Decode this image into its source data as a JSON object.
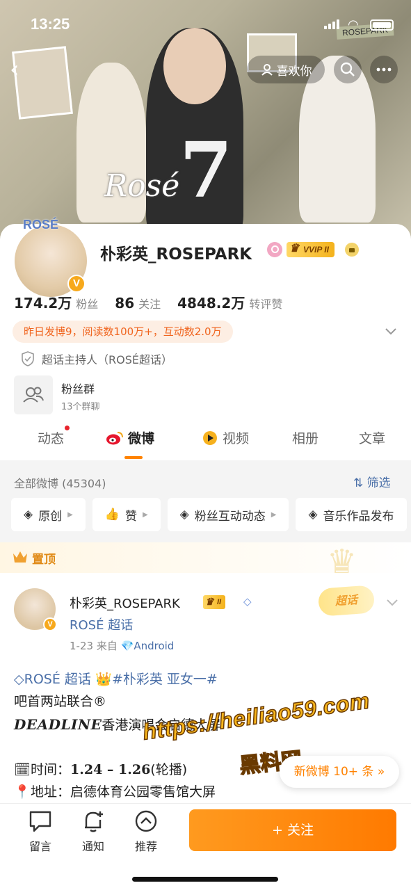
{
  "status_bar": {
    "time": "13:25"
  },
  "banner": {
    "like_label": "喜欢你",
    "stamp_tag": "ROSEPARK",
    "script_text": "Rosé"
  },
  "profile": {
    "name": "朴彩英_ROSEPARK",
    "vip_badge": "VVIP II",
    "verified_mark": "V",
    "avatar_caption": "ROSÉ",
    "stats": [
      {
        "num": "174.2万",
        "label": "粉丝"
      },
      {
        "num": "86",
        "label": "关注"
      },
      {
        "num": "4848.2万",
        "label": "转评赞"
      }
    ],
    "activity": "昨日发博9，阅读数100万+，互动数2.0万",
    "host": "超话主持人（ROSÉ超话）",
    "fan_group": {
      "title": "粉丝群",
      "subtitle": "13个群聊"
    }
  },
  "tabs": [
    {
      "label": "动态"
    },
    {
      "label": "微博"
    },
    {
      "label": "视频"
    },
    {
      "label": "相册"
    },
    {
      "label": "文章"
    }
  ],
  "filter": {
    "all_label": "全部微博 (45304)",
    "filter_label": "筛选",
    "chips": [
      "原创",
      "赞",
      "粉丝互动动态",
      "音乐作品发布"
    ]
  },
  "pinned": {
    "label": "置顶"
  },
  "post": {
    "author": "朴彩英_ROSEPARK",
    "badge": "II",
    "topic": "ROSÉ 超话",
    "date": "1-23",
    "from": "来自",
    "source": "Android",
    "super_topic_tag": "超话",
    "line1_topic": "ROSÉ 超话",
    "line1_hashtag": "#朴彩英 亚女一#",
    "line2": "吧首两站联合®",
    "line3_bold": "DEADLINE",
    "line3_rest": "香港演唱会启德大屏",
    "line4_label": "时间：",
    "line4_value": "1.24 – 1.26",
    "line4_note": "(轮播)",
    "line5_label": "地址：",
    "line5_value": "启德体育公园零售馆大屏"
  },
  "watermark": {
    "url": "https://heiliao59.com",
    "name": "黑料网"
  },
  "new_posts": "新微博 10+ 条",
  "bottom_bar": {
    "comment": "留言",
    "notify": "通知",
    "recommend": "推荐",
    "follow": "+ 关注"
  },
  "colors": {
    "accent": "#ff8200",
    "link": "#4a6fa8",
    "activity_text": "#f0641e"
  }
}
